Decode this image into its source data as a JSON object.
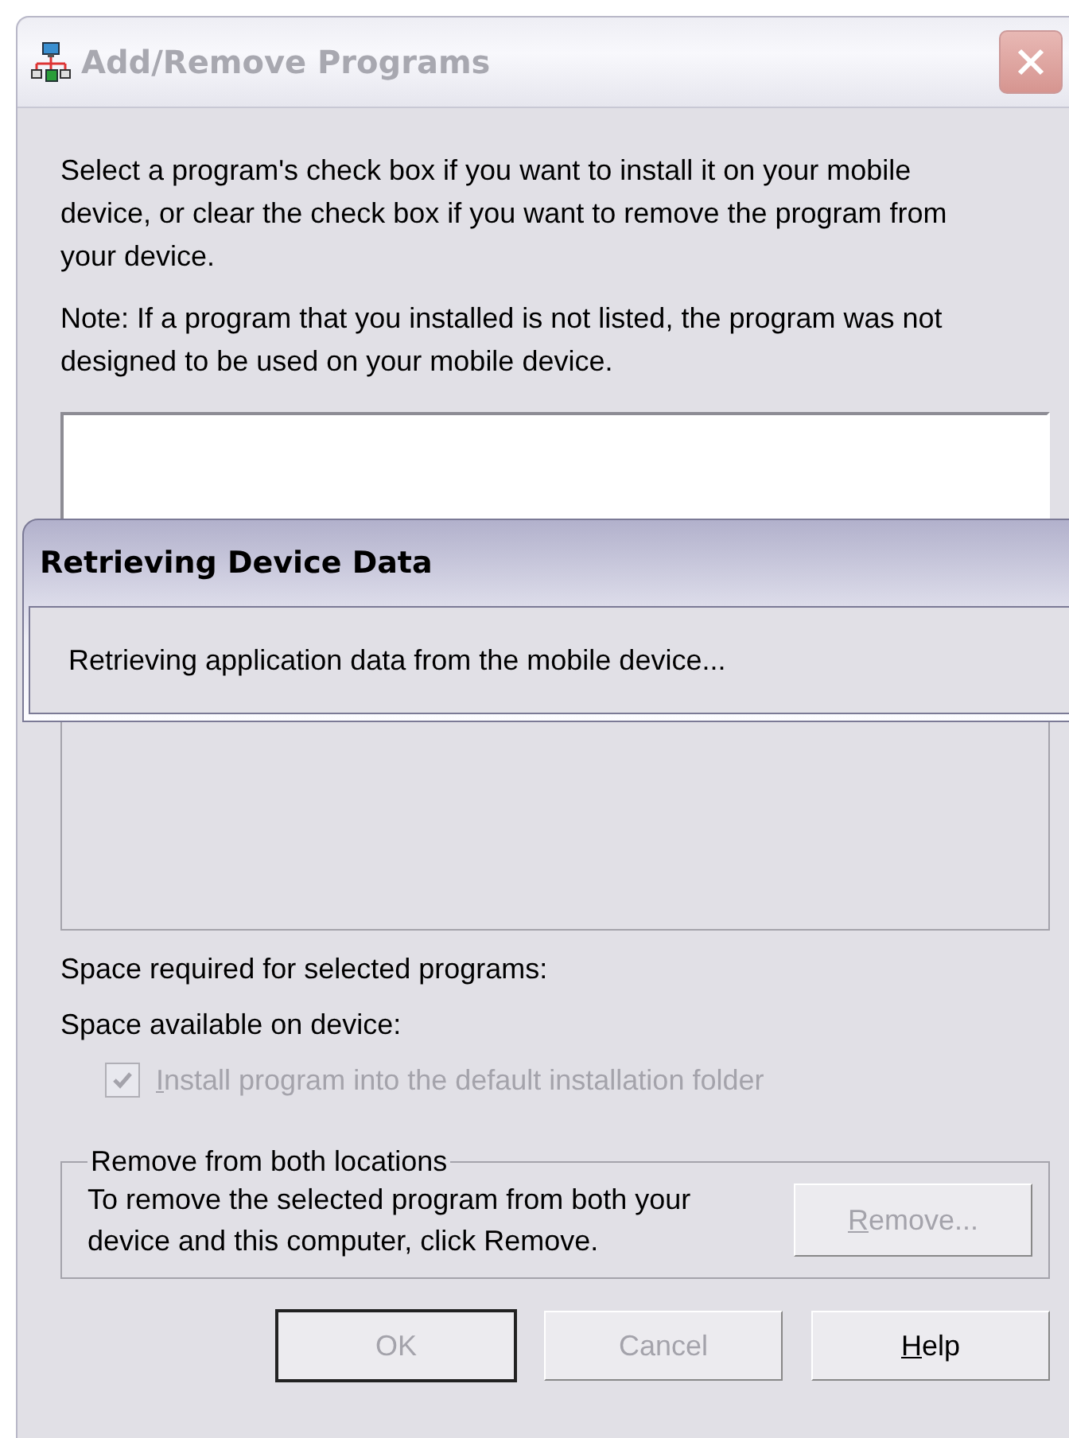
{
  "window": {
    "title": "Add/Remove Programs",
    "active": false
  },
  "instructions": "Select a program's check box if you want to install it on your mobile device, or clear the check box if you want to remove the program from your device.",
  "note": "Note:  If a program that you installed is not listed, the program was not designed to be used on your mobile device.",
  "space_required": {
    "label": "Space required for selected programs:"
  },
  "space_available": {
    "label": "Space available on device:"
  },
  "default_folder_checkbox": {
    "label": "Install program into the default installation folder",
    "checked": true,
    "disabled": true,
    "underline_first": true
  },
  "remove_group": {
    "title": "Remove from both locations",
    "text": "To remove the selected program from both your device and this computer, click Remove.",
    "button": {
      "label": "Remove...",
      "disabled": true,
      "underline_first": true
    }
  },
  "buttons": [
    {
      "label": "OK",
      "disabled": true,
      "default": true,
      "underline_first": false
    },
    {
      "label": "Cancel",
      "disabled": true,
      "default": false,
      "underline_first": false
    },
    {
      "label": "Help",
      "disabled": false,
      "default": false,
      "underline_first": true
    }
  ],
  "progress_dialog": {
    "title": "Retrieving Device Data",
    "message": "Retrieving application data from the mobile device..."
  }
}
